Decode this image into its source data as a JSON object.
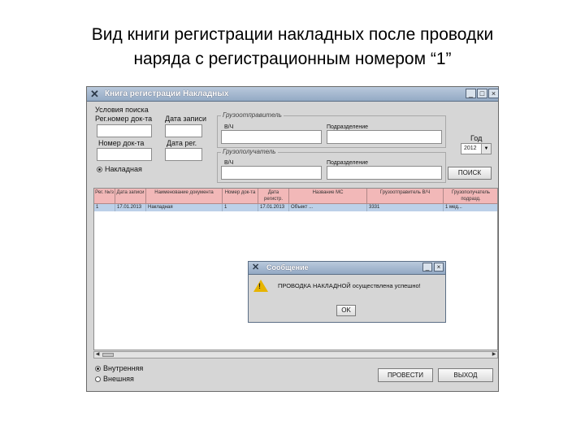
{
  "slide": {
    "title_line1": "Вид книги регистрации накладных после проводки",
    "title_line2": "наряда с регистрационным номером “1”"
  },
  "window": {
    "icon": "x-app-icon",
    "title": "Книга регистрации Накладных",
    "controls": [
      "_",
      "□",
      "×"
    ]
  },
  "search": {
    "group_label": "Условия поиска",
    "reg_number_label": "Рег.номер док-та",
    "record_date_label": "Дата записи",
    "doc_number_label": "Номер док-та",
    "reg_date_label": "Дата рег.",
    "radio_invoice_label": "Накладная",
    "sender_group_label": "Грузоотправитель",
    "receiver_group_label": "Грузополучатель",
    "vch_label": "В/Ч",
    "division_label": "Подразделение",
    "year_label": "Год",
    "year_value": "2012",
    "search_button": "ПОИСК"
  },
  "table": {
    "columns": [
      "Рег. №/з",
      "Дата записи",
      "Наименование документа",
      "Номер док-та",
      "Дата регистр.",
      "Название МС",
      "Грузоотправитель В/Ч",
      "Грузополучатель подразд."
    ],
    "rows": [
      [
        "1",
        "17.01.2013",
        "Накладная",
        "1",
        "17.01.2013",
        "Объект ...",
        "3331",
        "1 мед..."
      ]
    ]
  },
  "dialog": {
    "title": "Сообщение",
    "icon": "warning-icon",
    "message": "ПРОВОДКА НАКЛАДНОЙ осуществлена успешно!",
    "ok_button": "OK"
  },
  "bottom": {
    "radio_internal": "Внутренняя",
    "radio_external": "Внешняя",
    "post_button": "ПРОВЕСТИ",
    "exit_button": "ВЫХОД"
  },
  "colors": {
    "header_pink": "#f2b8b8",
    "selected_row": "#bcd0e8",
    "titlebar": "#93a9c4"
  }
}
